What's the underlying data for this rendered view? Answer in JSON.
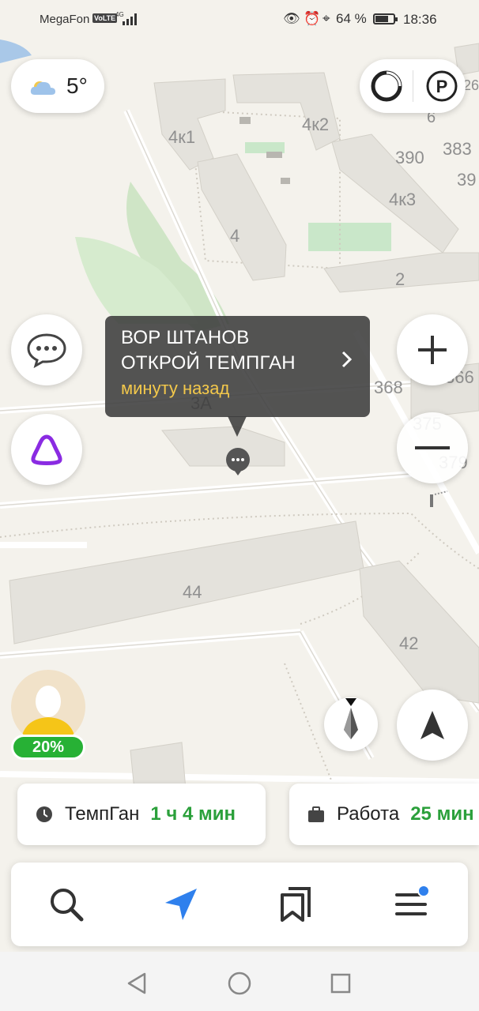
{
  "status_bar": {
    "carrier": "MegaFon",
    "volte": "VoLTE",
    "network": "4G",
    "battery": "64 %",
    "time": "18:36"
  },
  "weather": {
    "temperature": "5°",
    "icon": "cloud-icon"
  },
  "map_labels": [
    "4к1",
    "4к2",
    "6",
    "390",
    "383",
    "39",
    "4к3",
    "4",
    "2",
    "3А",
    "368",
    "366",
    "375",
    "379",
    "44",
    "42",
    "26"
  ],
  "callout": {
    "line1": "ВОР ШТАНОВ",
    "line2": "ОТКРОЙ ТЕМПГАН",
    "time": "минуту назад"
  },
  "avatar": {
    "battery": "20%"
  },
  "routes": [
    {
      "name": "ТемпГан",
      "duration": "1 ч 4 мин",
      "icon": "clock-icon"
    },
    {
      "name": "Работа",
      "duration": "25 мин",
      "icon": "briefcase-icon"
    }
  ],
  "colors": {
    "accent_blue": "#2f80ed",
    "green": "#27b135",
    "alice_purple": "#8a2be2",
    "callout_bg": "#3c3c3c",
    "callout_time": "#f3c84b"
  }
}
